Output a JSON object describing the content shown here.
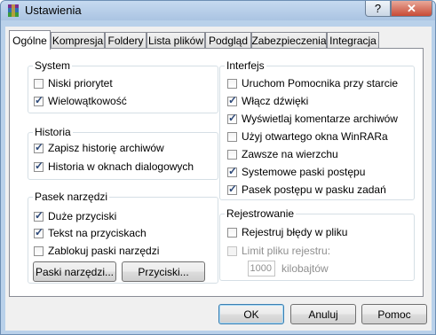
{
  "window": {
    "title": "Ustawienia",
    "help_label": "?",
    "close_label": "✕"
  },
  "tabs": [
    {
      "label": "Ogólne"
    },
    {
      "label": "Kompresja"
    },
    {
      "label": "Foldery"
    },
    {
      "label": "Lista plików"
    },
    {
      "label": "Podgląd"
    },
    {
      "label": "Zabezpieczenia"
    },
    {
      "label": "Integracja"
    }
  ],
  "system": {
    "label": "System",
    "items": [
      {
        "label": "Niski priorytet",
        "checked": false
      },
      {
        "label": "Wielowątkowość",
        "checked": true
      }
    ]
  },
  "history": {
    "label": "Historia",
    "items": [
      {
        "label": "Zapisz historię archiwów",
        "checked": true
      },
      {
        "label": "Historia w oknach dialogowych",
        "checked": true
      }
    ]
  },
  "toolbar": {
    "label": "Pasek narzędzi",
    "items": [
      {
        "label": "Duże przyciski",
        "checked": true
      },
      {
        "label": "Tekst na przyciskach",
        "checked": true
      },
      {
        "label": "Zablokuj paski narzędzi",
        "checked": false
      }
    ],
    "toolbars_button": "Paski narzędzi...",
    "buttons_button": "Przyciski..."
  },
  "interface": {
    "label": "Interfejs",
    "items": [
      {
        "label": "Uruchom Pomocnika przy starcie",
        "checked": false
      },
      {
        "label": "Włącz dźwięki",
        "checked": true
      },
      {
        "label": "Wyświetlaj komentarze archiwów",
        "checked": true
      },
      {
        "label": "Użyj otwartego okna WinRARa",
        "checked": false
      },
      {
        "label": "Zawsze na wierzchu",
        "checked": false
      },
      {
        "label": "Systemowe paski postępu",
        "checked": true
      },
      {
        "label": "Pasek postępu w pasku zadań",
        "checked": true
      }
    ]
  },
  "logging": {
    "label": "Rejestrowanie",
    "items": [
      {
        "label": "Rejestruj błędy w pliku",
        "checked": false,
        "disabled": false
      },
      {
        "label": "Limit pliku rejestru:",
        "checked": false,
        "disabled": true
      }
    ],
    "limit_value": "1000",
    "limit_unit": "kilobajtów"
  },
  "footer": {
    "ok": "OK",
    "cancel": "Anuluj",
    "help": "Pomoc"
  }
}
